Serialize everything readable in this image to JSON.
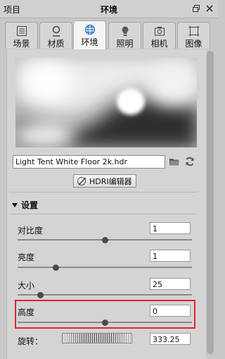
{
  "window": {
    "left_label": "项目",
    "title": "环境",
    "restore_icon": "restore-icon",
    "close_icon": "close-icon"
  },
  "tabs": [
    {
      "label": "场景",
      "icon": "list-icon",
      "active": false
    },
    {
      "label": "材质",
      "icon": "material-icon",
      "active": false
    },
    {
      "label": "环境",
      "icon": "globe-icon",
      "active": true
    },
    {
      "label": "照明",
      "icon": "bulb-icon",
      "active": false
    },
    {
      "label": "相机",
      "icon": "camera-icon",
      "active": false
    },
    {
      "label": "图像",
      "icon": "image-icon",
      "active": false
    }
  ],
  "environment": {
    "file_name": "Light Tent White Floor 2k.hdr",
    "hdri_button": "HDRI编辑器"
  },
  "settings": {
    "title": "设置",
    "params": [
      {
        "label": "对比度",
        "value": "1",
        "slider": 0.5
      },
      {
        "label": "亮度",
        "value": "1",
        "slider": 0.22
      },
      {
        "label": "大小",
        "value": "25",
        "slider": 0.13
      },
      {
        "label": "高度",
        "value": "0",
        "slider": 0.5
      }
    ],
    "rotation": {
      "label": "旋转：",
      "value": "333.25"
    }
  },
  "colors": {
    "highlight": "#e0252b"
  }
}
